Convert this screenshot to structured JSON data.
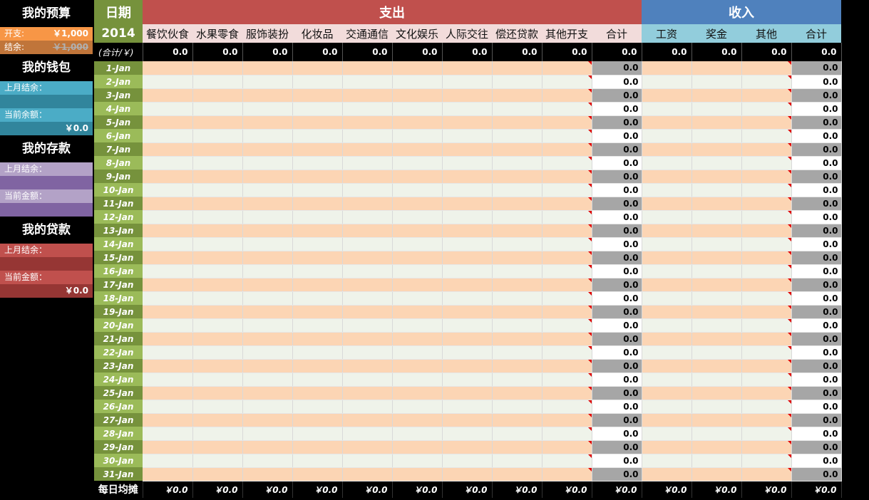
{
  "sidebar": {
    "budget": {
      "title": "我的预算",
      "spend_label": "开支:",
      "spend_value": "￥1,000",
      "balance_label": "结余:",
      "balance_value": "￥1,000"
    },
    "wallet": {
      "title": "我的钱包",
      "prev_label": "上月结余：",
      "prev_value": "",
      "current_label": "当前余额：",
      "current_value": "￥0.0"
    },
    "deposit": {
      "title": "我的存款",
      "prev_label": "上月结余：",
      "prev_value": "",
      "current_label": "当前金额：",
      "current_value": ""
    },
    "loan": {
      "title": "我的贷款",
      "prev_label": "上月结余：",
      "prev_value": "",
      "current_label": "当前金额：",
      "current_value": "￥0.0"
    }
  },
  "header": {
    "date_title": "日期",
    "expense_title": "支出",
    "income_title": "收入",
    "year": "2014",
    "total_label": "(合计/￥)",
    "expense_categories": [
      "餐饮伙食",
      "水果零食",
      "服饰装扮",
      "化妆品",
      "交通通信",
      "文化娱乐",
      "人际交往",
      "偿还贷款",
      "其他开支",
      "合计"
    ],
    "income_categories": [
      "工资",
      "奖金",
      "其他",
      "合计"
    ]
  },
  "totals": {
    "expense": [
      "0.0",
      "0.0",
      "0.0",
      "0.0",
      "0.0",
      "0.0",
      "0.0",
      "0.0",
      "0.0",
      "0.0"
    ],
    "income": [
      "0.0",
      "0.0",
      "0.0",
      "0.0"
    ]
  },
  "days": [
    "1-Jan",
    "2-Jan",
    "3-Jan",
    "4-Jan",
    "5-Jan",
    "6-Jan",
    "7-Jan",
    "8-Jan",
    "9-Jan",
    "10-Jan",
    "11-Jan",
    "12-Jan",
    "13-Jan",
    "14-Jan",
    "15-Jan",
    "16-Jan",
    "17-Jan",
    "18-Jan",
    "19-Jan",
    "20-Jan",
    "21-Jan",
    "22-Jan",
    "23-Jan",
    "24-Jan",
    "25-Jan",
    "26-Jan",
    "27-Jan",
    "28-Jan",
    "29-Jan",
    "30-Jan",
    "31-Jan"
  ],
  "day_expense_total": "0.0",
  "day_income_total": "0.0",
  "footer": {
    "label": "每日均摊",
    "expense": [
      "￥0.0",
      "￥0.0",
      "￥0.0",
      "￥0.0",
      "￥0.0",
      "￥0.0",
      "￥0.0",
      "￥0.0",
      "￥0.0",
      "￥0.0"
    ],
    "income": [
      "￥0.0",
      "￥0.0",
      "￥0.0",
      "￥0.0"
    ]
  },
  "colors": {
    "expense_header": "#c0504d",
    "income_header": "#4f81bd",
    "date_header": "#76923c",
    "expense_subheader": "#f2dcdb",
    "income_subheader": "#92cddc",
    "row_peach": "#fcd5b4",
    "row_light": "#eff3ea",
    "date_dark": "#76923c",
    "date_light": "#9bbb59",
    "sum_gray": "#a6a6a6",
    "sum_white": "#ffffff",
    "budget_orange": "#f79646",
    "budget_orange_dark": "#c0753a",
    "wallet_teal": "#4bacc6",
    "wallet_teal_dark": "#31859c",
    "deposit_lilac": "#b3a2c7",
    "deposit_purple": "#8064a2",
    "loan_red": "#c0504d",
    "loan_red_dark": "#963634"
  }
}
